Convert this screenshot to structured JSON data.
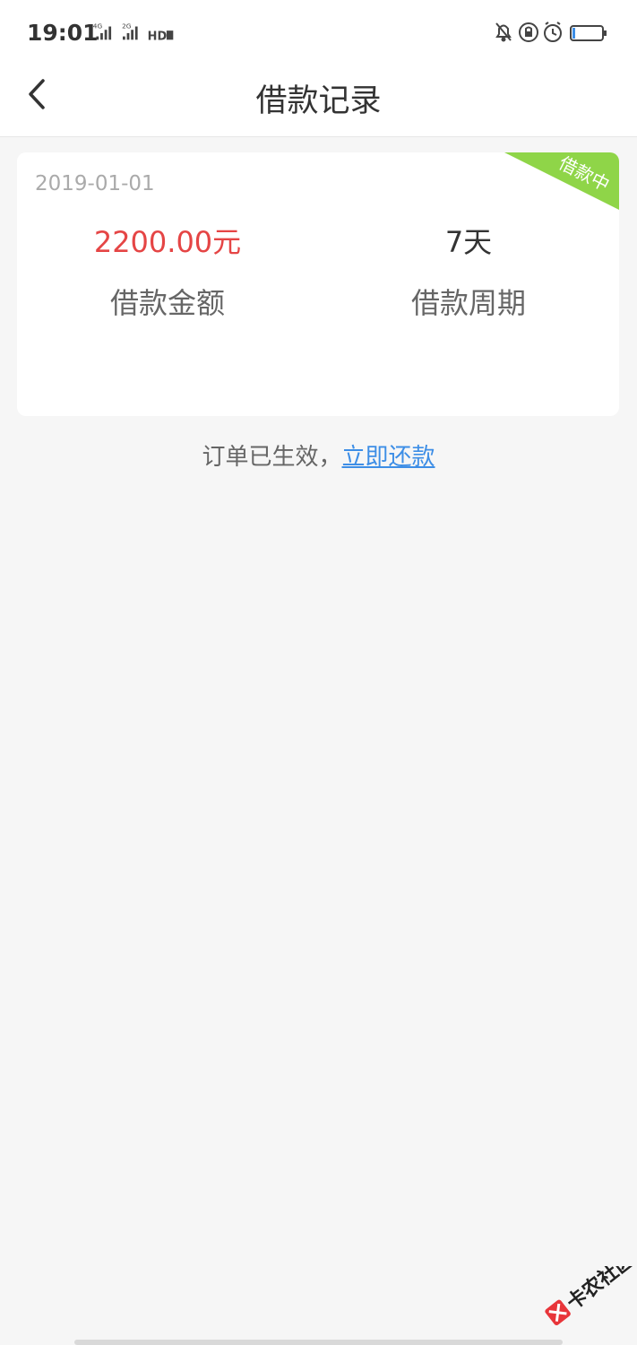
{
  "status_bar": {
    "time": "19:01",
    "signal1_label": "4G",
    "signal2_label": "2G",
    "hd_label": "HD"
  },
  "nav": {
    "title": "借款记录"
  },
  "loan_card": {
    "date": "2019-01-01",
    "status_badge": "借款中",
    "amount": "2200.00元",
    "amount_label": "借款金额",
    "period": "7天",
    "period_label": "借款周期"
  },
  "notice": {
    "text": "订单已生效，",
    "link": "立即还款"
  },
  "watermark": {
    "text": "卡农社区"
  },
  "colors": {
    "accent_red": "#e54545",
    "badge_green": "#8fd548",
    "link_blue": "#3d8ee6"
  }
}
